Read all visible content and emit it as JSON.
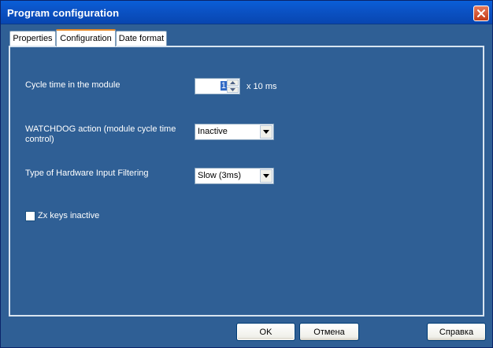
{
  "window": {
    "title": "Program configuration"
  },
  "tabs": [
    {
      "label": "Properties",
      "selected": false
    },
    {
      "label": "Configuration",
      "selected": true
    },
    {
      "label": "Date format",
      "selected": false
    }
  ],
  "config": {
    "cycle_time": {
      "label": "Cycle time in the module",
      "value": "1",
      "unit": "x 10 ms"
    },
    "watchdog": {
      "label_line1": "WATCHDOG action (module cycle time",
      "label_line2": "control)",
      "value": "Inactive"
    },
    "filtering": {
      "label": "Type of Hardware Input Filtering",
      "value": "Slow (3ms)"
    },
    "zx_keys": {
      "label": "Zx keys inactive",
      "checked": false
    }
  },
  "buttons": {
    "ok": "OK",
    "cancel": "Отмена",
    "help": "Справка"
  },
  "icons": {
    "close": "close-icon",
    "spin_up": "arrow-up-icon",
    "spin_down": "arrow-down-icon",
    "dropdown": "chevron-down-icon"
  },
  "colors": {
    "panel_bg": "#2f5f95",
    "titlebar": "#0b53c6",
    "selected_tab_accent": "#e68b2c"
  }
}
